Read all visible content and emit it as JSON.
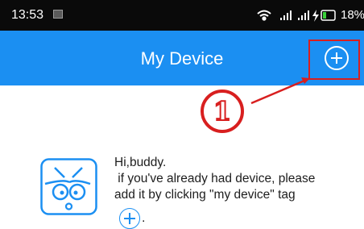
{
  "status_bar": {
    "time": "13:53",
    "battery_percent": "18%",
    "icons": [
      "image-notification-icon",
      "wifi-icon",
      "signal-icon",
      "signal-icon",
      "charging-icon",
      "battery-icon"
    ]
  },
  "header": {
    "title": "My Device",
    "add_icon": "plus-circle-icon"
  },
  "annotation": {
    "step_number": "1",
    "color": "#d81f1f"
  },
  "message": {
    "line1": "Hi,buddy.",
    "line2": " if you've already had device, please",
    "line3": "add it by clicking \"my device\" tag",
    "trailing": ".",
    "device_icon": "device-face-icon",
    "inline_add_icon": "plus-circle-icon"
  },
  "colors": {
    "header_bg": "#1b8ff2",
    "status_bg": "#0a0a0a",
    "accent": "#1b8ff2"
  }
}
